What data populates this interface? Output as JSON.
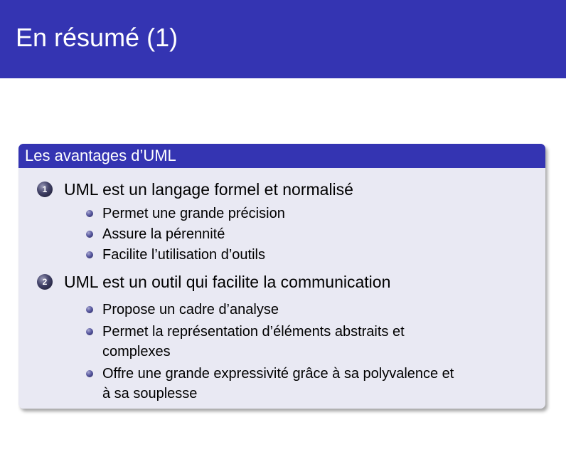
{
  "slide": {
    "title": "En résumé (1)",
    "block_title": "Les avantages d’UML",
    "items": [
      {
        "number": "1",
        "text": "UML est un langage formel et normalisé",
        "subitems": [
          {
            "lines": [
              "Permet une grande précision"
            ]
          },
          {
            "lines": [
              "Assure la pérennité"
            ]
          },
          {
            "lines": [
              "Facilite l’utilisation d’outils"
            ]
          }
        ]
      },
      {
        "number": "2",
        "text": "UML est un outil qui facilite la communication",
        "subitems": [
          {
            "lines": [
              "Propose un cadre d’analyse"
            ]
          },
          {
            "lines": [
              "Permet la représentation d’éléments abstraits et",
              "complexes"
            ]
          },
          {
            "lines": [
              "Offre une grande expressivité grâce à sa polyvalence et",
              "à sa souplesse"
            ]
          }
        ]
      }
    ]
  }
}
